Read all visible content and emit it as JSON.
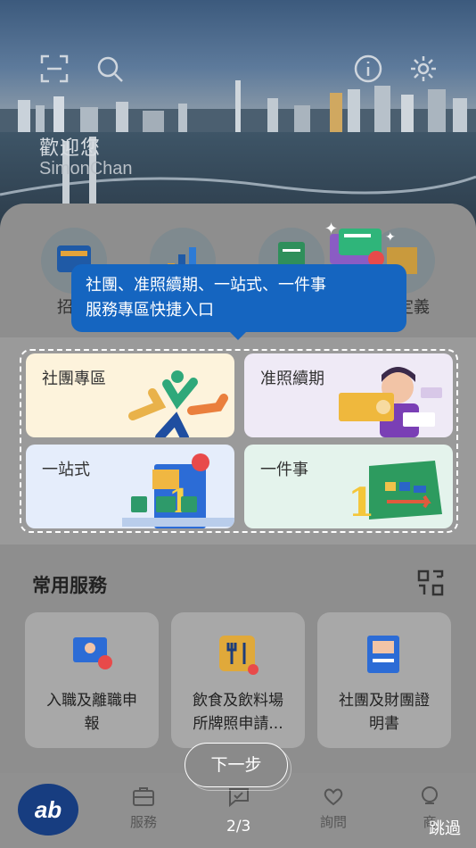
{
  "header": {
    "welcome": "歡迎您",
    "username": "SimonChan",
    "icons": [
      "scan-icon",
      "search-icon",
      "info-icon",
      "settings-icon"
    ]
  },
  "quick_row": {
    "items": [
      {
        "label": "招",
        "icon": "job-icon"
      },
      {
        "label": "",
        "icon": "chart-icon"
      },
      {
        "label": "",
        "icon": "document-icon"
      },
      {
        "label": "",
        "icon": "building-icon"
      },
      {
        "label": "定義",
        "icon": "custom-icon"
      }
    ]
  },
  "tooltip": {
    "text_line1": "社團、准照續期、一站式、一件事",
    "text_line2": "服務專區快捷入口"
  },
  "cards": [
    {
      "title": "社團專區"
    },
    {
      "title": "准照續期"
    },
    {
      "title": "一站式"
    },
    {
      "title": "一件事"
    }
  ],
  "common": {
    "title": "常用服務",
    "services": [
      {
        "line1": "入職及離職申",
        "line2": "報"
      },
      {
        "line1": "飲食及飲料場",
        "line2": "所牌照申請..."
      },
      {
        "line1": "社團及財團證",
        "line2": "明書"
      }
    ]
  },
  "nav": {
    "logo": "ab",
    "items": [
      {
        "label": "服務"
      },
      {
        "label": ""
      },
      {
        "label": "詢問"
      },
      {
        "label": "商"
      }
    ]
  },
  "guide": {
    "next": "下一步",
    "page": "2/3",
    "skip": "跳過"
  },
  "colors": {
    "accent": "#1565c0",
    "card_yellow": "#fdf3dc",
    "card_purple": "#efeaf6",
    "card_blue": "#e5edfb",
    "card_green": "#e4f3ec"
  }
}
